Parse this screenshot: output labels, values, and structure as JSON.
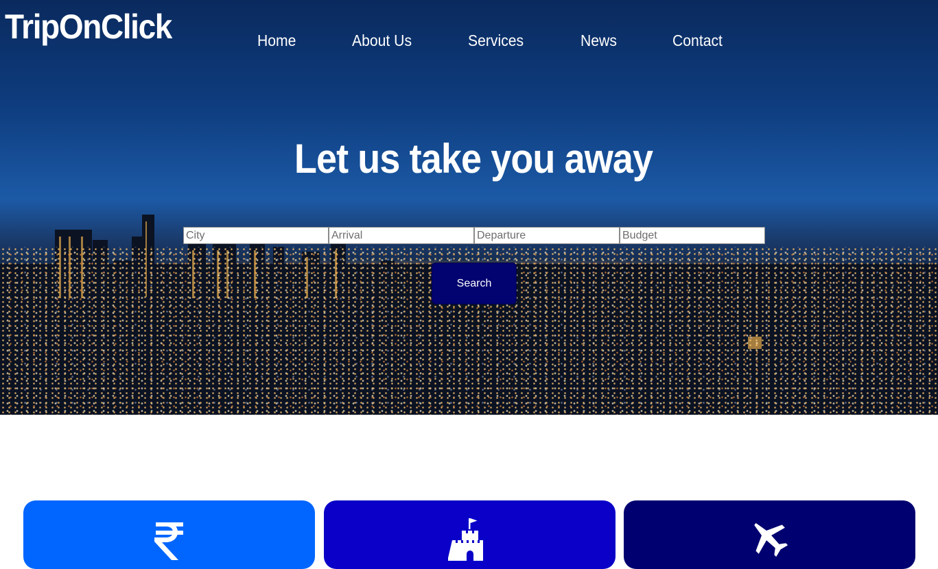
{
  "header": {
    "logo": "TripOnClick",
    "nav": [
      {
        "label": "Home"
      },
      {
        "label": "About Us"
      },
      {
        "label": "Services"
      },
      {
        "label": "News"
      },
      {
        "label": "Contact"
      }
    ]
  },
  "hero": {
    "headline": "Let us take you away",
    "search": {
      "city_placeholder": "City",
      "arrival_placeholder": "Arrival",
      "departure_placeholder": "Departure",
      "budget_placeholder": "Budget",
      "button_label": "Search"
    }
  },
  "features": [
    {
      "icon": "rupee-icon",
      "color": "#0066ff"
    },
    {
      "icon": "castle-icon",
      "color": "#0a00c8"
    },
    {
      "icon": "airplane-icon",
      "color": "#000070"
    }
  ],
  "colors": {
    "search_button": "#020270",
    "text_on_dark": "#ffffff"
  }
}
